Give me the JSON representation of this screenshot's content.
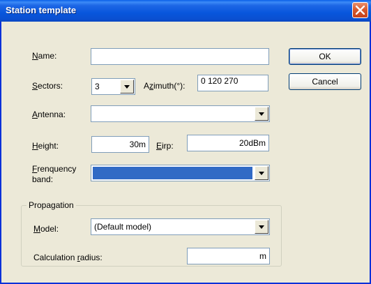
{
  "window": {
    "title": "Station template"
  },
  "buttons": {
    "ok": "OK",
    "cancel": "Cancel"
  },
  "fields": {
    "name": {
      "label": "Name:",
      "value": ""
    },
    "sectors": {
      "label": "Sectors:",
      "value": "3"
    },
    "azimuth": {
      "label": "Azimuth(°):",
      "value": "0 120 270"
    },
    "antenna": {
      "label": "Antenna:",
      "value": ""
    },
    "height": {
      "label": "Height:",
      "value": "30m"
    },
    "eirp": {
      "label": "Eirp:",
      "value": "20dBm"
    },
    "frequency_band": {
      "label_line1": "Frenquency",
      "label_line2": "band:",
      "value": ""
    }
  },
  "propagation": {
    "title": "Propagation",
    "model": {
      "label": "Model:",
      "value": "(Default model)"
    },
    "radius": {
      "label": "Calculation radius:",
      "value": "m"
    }
  },
  "colors": {
    "selection": "#316AC5",
    "titlebar": "#0A5FE8",
    "close": "#D85A2E"
  },
  "icons": {
    "close": "close-x-icon",
    "dropdown": "chevron-down-icon"
  }
}
